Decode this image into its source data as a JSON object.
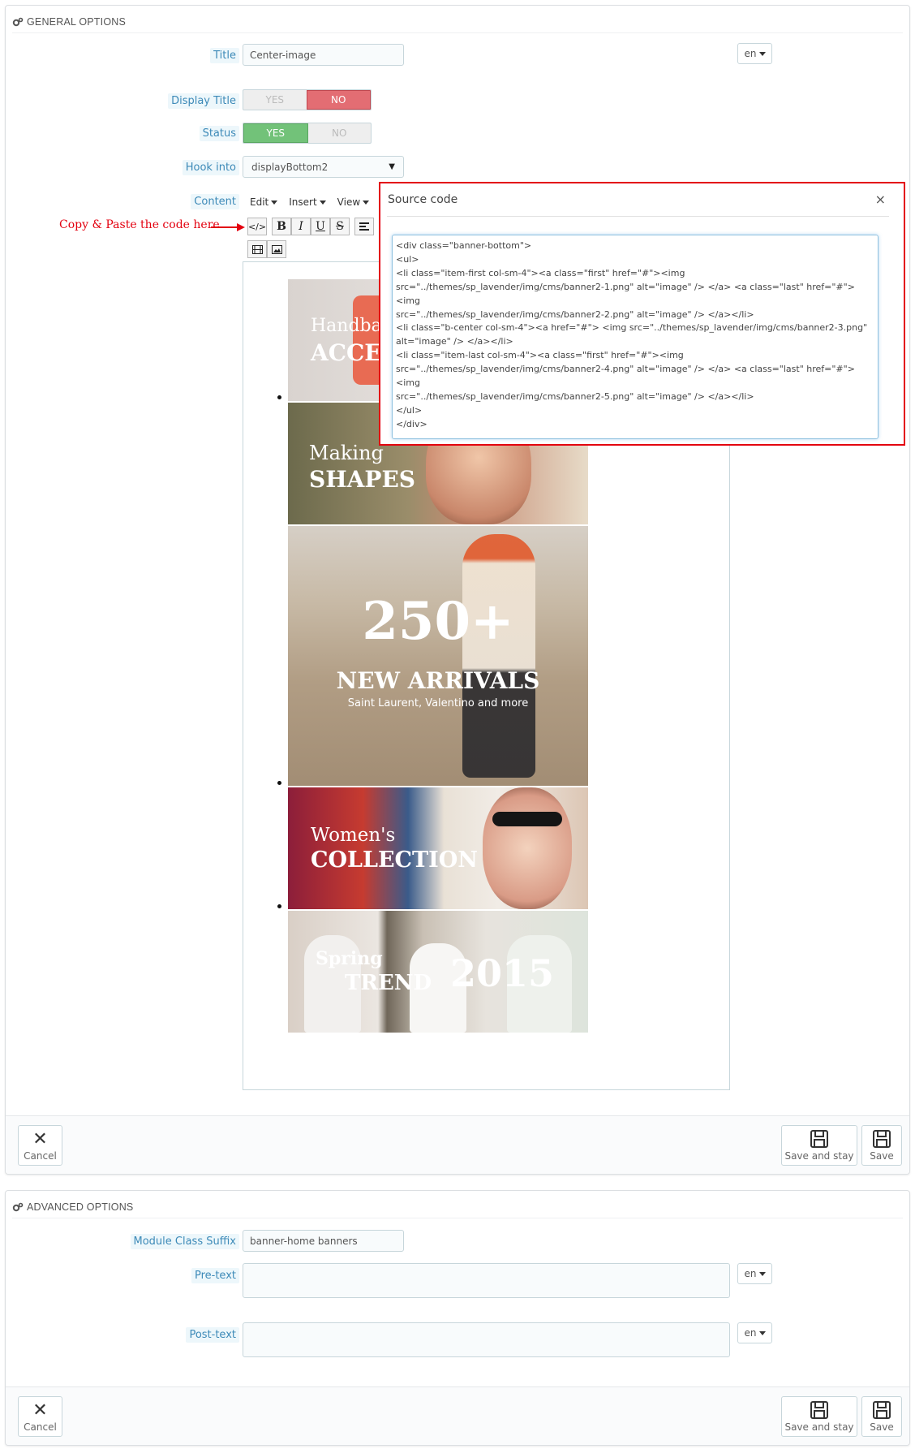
{
  "general": {
    "header": "GENERAL OPTIONS",
    "title_label": "Title",
    "title_value": "Center-image",
    "lang": "en",
    "display_title_label": "Display Title",
    "status_label": "Status",
    "yes": "YES",
    "no": "NO",
    "hook_label": "Hook into",
    "hook_value": "displayBottom2",
    "content_label": "Content",
    "menu": [
      "Edit",
      "Insert",
      "View"
    ],
    "annotation": "Copy & Paste the code here",
    "cancel": "Cancel",
    "save_stay": "Save and stay",
    "save": "Save"
  },
  "source_modal": {
    "title": "Source code",
    "close": "×",
    "code": "<div class=\"banner-bottom\">\n<ul>\n<li class=\"item-first col-sm-4\"><a class=\"first\" href=\"#\"><img\nsrc=\"../themes/sp_lavender/img/cms/banner2-1.png\" alt=\"image\" /> </a> <a class=\"last\" href=\"#\"><img\nsrc=\"../themes/sp_lavender/img/cms/banner2-2.png\" alt=\"image\" /> </a></li>\n<li class=\"b-center col-sm-4\"><a href=\"#\"> <img src=\"../themes/sp_lavender/img/cms/banner2-3.png\"\nalt=\"image\" /> </a></li>\n<li class=\"item-last col-sm-4\"><a class=\"first\" href=\"#\"><img\nsrc=\"../themes/sp_lavender/img/cms/banner2-4.png\" alt=\"image\" /> </a> <a class=\"last\" href=\"#\"> <img\nsrc=\"../themes/sp_lavender/img/cms/banner2-5.png\" alt=\"image\" /> </a></li>\n</ul>\n</div>"
  },
  "banners": {
    "b1_line1": "Handbag",
    "b1_line2": "ACCES",
    "b2_line1": "Making",
    "b2_line2": "SHAPES",
    "b3_big": "250+",
    "b3_line2": "NEW ARRIVALS",
    "b3_line3": "Saint Laurent, Valentino and more",
    "b4_line1": "Women's",
    "b4_line2": "COLLECTION",
    "b5_line1": "Spring",
    "b5_line2": "TREND",
    "b5_year": "2015"
  },
  "advanced": {
    "header": "ADVANCED OPTIONS",
    "suffix_label": "Module Class Suffix",
    "suffix_value": "banner-home banners",
    "pretext_label": "Pre-text",
    "posttext_label": "Post-text",
    "lang": "en",
    "cancel": "Cancel",
    "save_stay": "Save and stay",
    "save": "Save"
  },
  "colors": {
    "accent_label": "#3d8ab8",
    "yes_green": "#72c279",
    "no_red": "#e36d73",
    "annotation_red": "#e3000f"
  }
}
